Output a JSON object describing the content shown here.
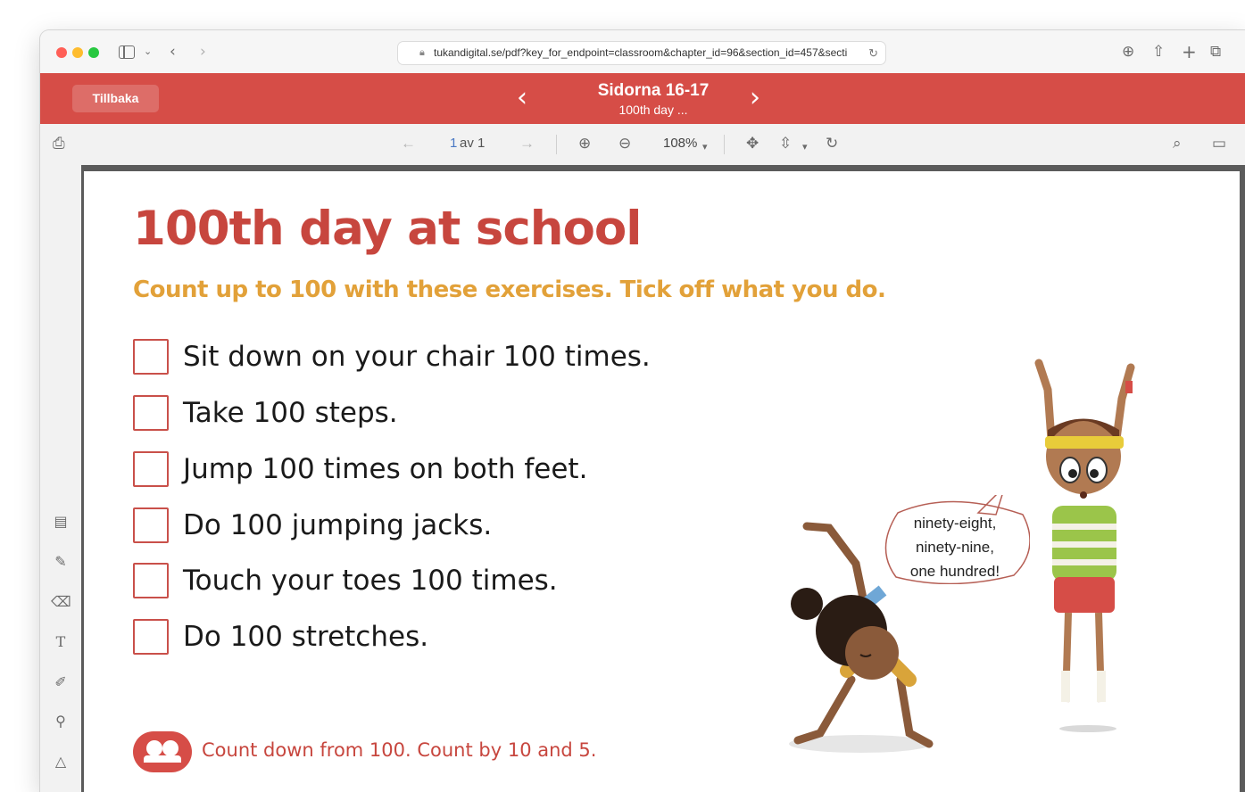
{
  "browser": {
    "url": "tukandigital.se/pdf?key_for_endpoint=classroom&chapter_id=96&section_id=457&secti",
    "icons": [
      "sidebar-icon",
      "chevron-left-icon",
      "chevron-right-icon",
      "lock-icon",
      "reload-icon",
      "download-icon",
      "share-icon",
      "plus-icon",
      "tabs-icon"
    ]
  },
  "header": {
    "back_label": "Tillbaka",
    "title": "Sidorna 16-17",
    "subtitle": "100th day ...",
    "prev_glyph": "‹",
    "next_glyph": "›",
    "color": "#d64d47"
  },
  "pdf_toolbar": {
    "page_current": "1",
    "page_of": "av 1",
    "zoom": "108%"
  },
  "page": {
    "title": "100th day at school",
    "subtitle": "Count up to 100 with these exercises. Tick off what you do.",
    "tasks": [
      "Sit down on your chair 100 times.",
      "Take 100 steps.",
      "Jump 100 times on both feet.",
      "Do 100 jumping jacks.",
      "Touch your toes 100 times.",
      "Do 100 stretches."
    ],
    "speech": [
      "ninety-eight,",
      "ninety-nine,",
      "one hundred!"
    ],
    "footer": "Count down from 100. Count by 10 and 5.",
    "colors": {
      "title": "#c7463e",
      "subtitle": "#e2a139",
      "checkbox": "#c9504a"
    }
  }
}
